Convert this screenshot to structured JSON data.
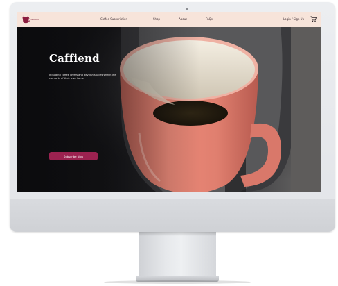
{
  "brand": {
    "logo_text": "Caffiend",
    "accent": "#9c2250",
    "nav_background": "#f7e4da"
  },
  "nav": {
    "links": [
      "Coffee Subscription",
      "Shop",
      "About",
      "FAQs"
    ],
    "login_label": "Login / Sign Up",
    "cart_icon": "cart-icon"
  },
  "hero": {
    "title": "Caffiend",
    "tagline": "Indulging coffee lovers and devilish spaces within the comforts of their own home",
    "cta_label": "Subscribe Now",
    "image": "pink-coffee-mug-on-coffee-machine"
  }
}
